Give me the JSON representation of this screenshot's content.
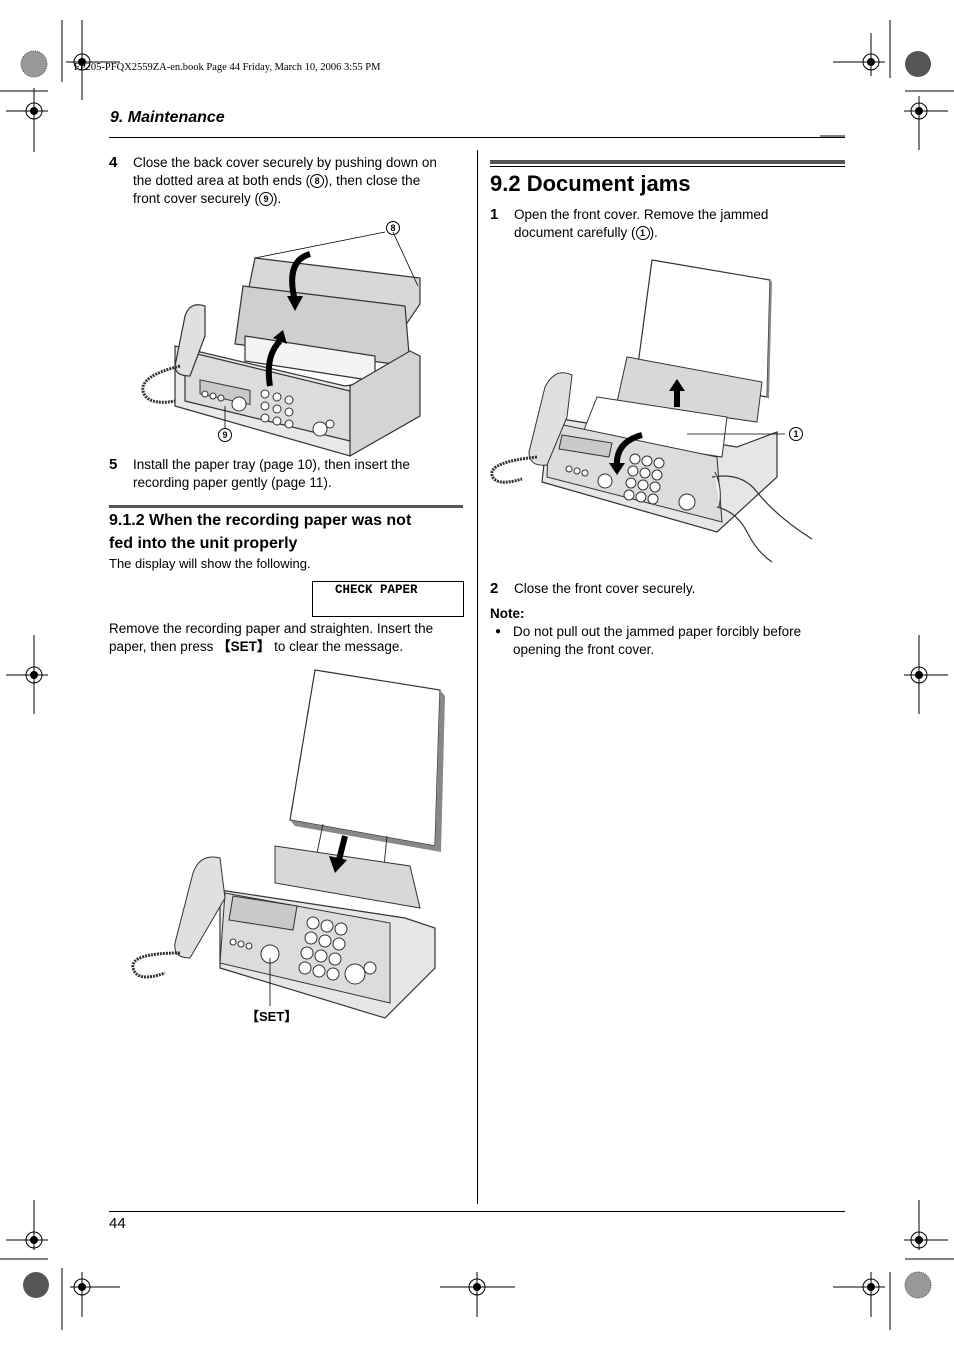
{
  "print_header": {
    "book_info": "FP205-PFQX2559ZA-en.book  Page 44  Friday, March 10, 2006  3:55 PM"
  },
  "page": {
    "section": "9. Maintenance",
    "page_number": "44"
  },
  "left_column": {
    "step4": {
      "number": "4",
      "line1": "Close the back cover securely by pushing down on",
      "line2_a": "the dotted area at both ends (",
      "callout_8": "8",
      "line2_b": "), then close the",
      "line3_a": "front cover securely (",
      "callout_9": "9",
      "line3_b": ")."
    },
    "figure1": {
      "callout_back": "8",
      "callout_front": "9",
      "alt": "fax-open-covers-illustration"
    },
    "step5": {
      "number": "5",
      "line1": "Install the paper tray (page 10), then insert the",
      "line2": "recording paper gently (page 11)."
    },
    "subsection": {
      "title_line1": "9.1.2 When the recording paper was not",
      "title_line2": "fed into the unit properly",
      "intro": "The display will show the following.",
      "display_text": "CHECK PAPER",
      "instruction_line1": "Remove the recording paper and straighten. Insert the",
      "instruction_line2_a": "paper, then press ",
      "set_key": "【SET】",
      "instruction_line2_b": " to clear the message."
    },
    "figure2": {
      "set_label": "【SET】",
      "alt": "fax-insert-paper-illustration"
    }
  },
  "right_column": {
    "title": "9.2 Document jams",
    "step1": {
      "number": "1",
      "line1": "Open the front cover. Remove the jammed",
      "line2_a": "document carefully (",
      "callout_1": "1",
      "line2_b": ")."
    },
    "figure3": {
      "callout_doc": "1",
      "alt": "fax-remove-jammed-document-illustration"
    },
    "step2": {
      "number": "2",
      "text": "Close the front cover securely."
    },
    "note": {
      "label": "Note:",
      "bullet": "●",
      "line1": "Do not pull out the jammed paper forcibly before",
      "line2": "opening the front cover."
    }
  }
}
